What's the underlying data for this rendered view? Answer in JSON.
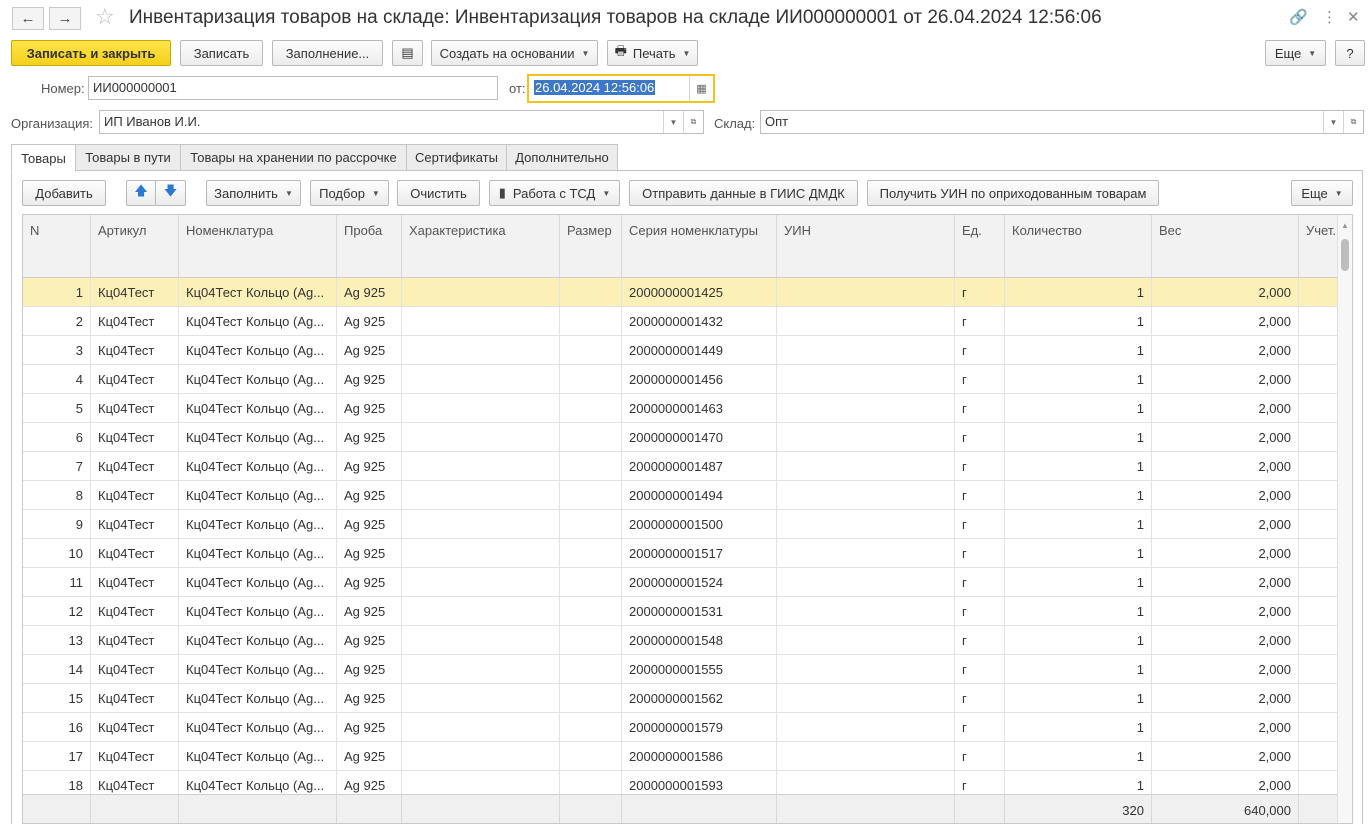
{
  "window": {
    "title": "Инвентаризация товаров на складе: Инвентаризация товаров на складе ИИ000000001 от 26.04.2024 12:56:06",
    "back_icon": "←",
    "forward_icon": "→",
    "star_icon": "☆",
    "link_icon": "🔗",
    "menu_icon": "⋮",
    "close_icon": "✕"
  },
  "toolbar": {
    "save_close": "Записать и закрыть",
    "save": "Записать",
    "fill": "Заполнение...",
    "create_based": "Создать на основании",
    "print": "Печать",
    "more": "Еще",
    "help": "?",
    "print_icon": "🖶",
    "doc_icon": "▤"
  },
  "form": {
    "number_label": "Номер:",
    "number_value": "ИИ000000001",
    "date_label": "от:",
    "date_value": "26.04.2024 12:56:06",
    "org_label": "Организация:",
    "org_value": "ИП Иванов И.И.",
    "warehouse_label": "Склад:",
    "warehouse_value": "Опт"
  },
  "tabs": [
    "Товары",
    "Товары в пути",
    "Товары на хранении по рассрочке",
    "Сертификаты",
    "Дополнительно"
  ],
  "table_toolbar": {
    "add": "Добавить",
    "fill": "Заполнить",
    "pick": "Подбор",
    "clear": "Очистить",
    "tsd": "Работа с ТСД",
    "send_giis": "Отправить данные в ГИИС ДМДК",
    "get_uin": "Получить УИН по оприходованным товарам",
    "more": "Еще",
    "up_icon": "🡅",
    "down_icon": "🡇",
    "tsd_icon": "▮"
  },
  "table": {
    "columns": [
      "N",
      "Артикул",
      "Номенклатура",
      "Проба",
      "Характеристика",
      "Размер",
      "Серия номенклатуры",
      "УИН",
      "Ед.",
      "Количество",
      "Вес",
      "Учет."
    ],
    "rows": [
      [
        "1",
        "Кц04Тест",
        "Кц04Тест Кольцо (Ag...",
        "Ag 925",
        "",
        "",
        "2000000001425",
        "",
        "г",
        "1",
        "2,000",
        ""
      ],
      [
        "2",
        "Кц04Тест",
        "Кц04Тест Кольцо (Ag...",
        "Ag 925",
        "",
        "",
        "2000000001432",
        "",
        "г",
        "1",
        "2,000",
        ""
      ],
      [
        "3",
        "Кц04Тест",
        "Кц04Тест Кольцо (Ag...",
        "Ag 925",
        "",
        "",
        "2000000001449",
        "",
        "г",
        "1",
        "2,000",
        ""
      ],
      [
        "4",
        "Кц04Тест",
        "Кц04Тест Кольцо (Ag...",
        "Ag 925",
        "",
        "",
        "2000000001456",
        "",
        "г",
        "1",
        "2,000",
        ""
      ],
      [
        "5",
        "Кц04Тест",
        "Кц04Тест Кольцо (Ag...",
        "Ag 925",
        "",
        "",
        "2000000001463",
        "",
        "г",
        "1",
        "2,000",
        ""
      ],
      [
        "6",
        "Кц04Тест",
        "Кц04Тест Кольцо (Ag...",
        "Ag 925",
        "",
        "",
        "2000000001470",
        "",
        "г",
        "1",
        "2,000",
        ""
      ],
      [
        "7",
        "Кц04Тест",
        "Кц04Тест Кольцо (Ag...",
        "Ag 925",
        "",
        "",
        "2000000001487",
        "",
        "г",
        "1",
        "2,000",
        ""
      ],
      [
        "8",
        "Кц04Тест",
        "Кц04Тест Кольцо (Ag...",
        "Ag 925",
        "",
        "",
        "2000000001494",
        "",
        "г",
        "1",
        "2,000",
        ""
      ],
      [
        "9",
        "Кц04Тест",
        "Кц04Тест Кольцо (Ag...",
        "Ag 925",
        "",
        "",
        "2000000001500",
        "",
        "г",
        "1",
        "2,000",
        ""
      ],
      [
        "10",
        "Кц04Тест",
        "Кц04Тест Кольцо (Ag...",
        "Ag 925",
        "",
        "",
        "2000000001517",
        "",
        "г",
        "1",
        "2,000",
        ""
      ],
      [
        "11",
        "Кц04Тест",
        "Кц04Тест Кольцо (Ag...",
        "Ag 925",
        "",
        "",
        "2000000001524",
        "",
        "г",
        "1",
        "2,000",
        ""
      ],
      [
        "12",
        "Кц04Тест",
        "Кц04Тест Кольцо (Ag...",
        "Ag 925",
        "",
        "",
        "2000000001531",
        "",
        "г",
        "1",
        "2,000",
        ""
      ],
      [
        "13",
        "Кц04Тест",
        "Кц04Тест Кольцо (Ag...",
        "Ag 925",
        "",
        "",
        "2000000001548",
        "",
        "г",
        "1",
        "2,000",
        ""
      ],
      [
        "14",
        "Кц04Тест",
        "Кц04Тест Кольцо (Ag...",
        "Ag 925",
        "",
        "",
        "2000000001555",
        "",
        "г",
        "1",
        "2,000",
        ""
      ],
      [
        "15",
        "Кц04Тест",
        "Кц04Тест Кольцо (Ag...",
        "Ag 925",
        "",
        "",
        "2000000001562",
        "",
        "г",
        "1",
        "2,000",
        ""
      ],
      [
        "16",
        "Кц04Тест",
        "Кц04Тест Кольцо (Ag...",
        "Ag 925",
        "",
        "",
        "2000000001579",
        "",
        "г",
        "1",
        "2,000",
        ""
      ],
      [
        "17",
        "Кц04Тест",
        "Кц04Тест Кольцо (Ag...",
        "Ag 925",
        "",
        "",
        "2000000001586",
        "",
        "г",
        "1",
        "2,000",
        ""
      ],
      [
        "18",
        "Кц04Тест",
        "Кц04Тест Кольцо (Ag...",
        "Ag 925",
        "",
        "",
        "2000000001593",
        "",
        "г",
        "1",
        "2,000",
        ""
      ]
    ],
    "totals": {
      "quantity": "320",
      "weight": "640,000"
    }
  }
}
